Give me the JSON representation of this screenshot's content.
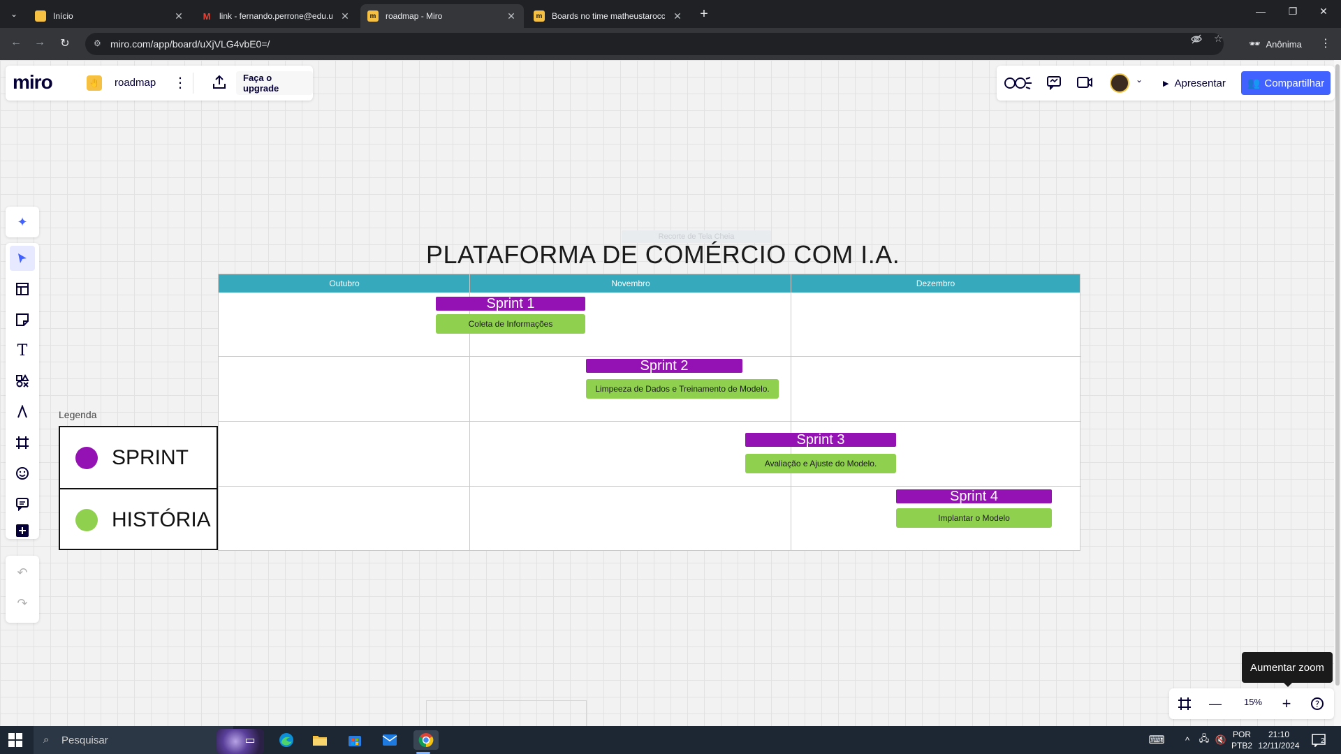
{
  "browser": {
    "tabs": [
      {
        "title": "Início",
        "favicon_color": "#f6c143",
        "favicon_glyph": "▣"
      },
      {
        "title": "link - fernando.perrone@edu.u",
        "favicon_color": "#ffffff",
        "favicon_glyph": "M"
      },
      {
        "title": "roadmap - Miro",
        "favicon_color": "#f6c143",
        "favicon_glyph": "m",
        "active": true
      },
      {
        "title": "Boards no time matheustarocc",
        "favicon_color": "#f6c143",
        "favicon_glyph": "m"
      }
    ],
    "url": "miro.com/app/board/uXjVLG4vbE0=/",
    "profile_label": "Anônima"
  },
  "miro": {
    "logo": "miro",
    "board_name": "roadmap",
    "upgrade_label": "Faça o upgrade",
    "present_label": "Apresentar",
    "share_label": "Compartilhar",
    "zoom_level": "15%",
    "tooltip": "Aumentar zoom",
    "brand_color": "#4262ff"
  },
  "board": {
    "ghost_label": "Recorte de Tela Cheia",
    "title": "PLATAFORMA DE COMÉRCIO COM I.A.",
    "months": [
      "Outubro",
      "Novembro",
      "Dezembro"
    ],
    "header_color": "#36a9bd",
    "sprints": [
      {
        "label": "Sprint 1",
        "story": "Coleta de Informações"
      },
      {
        "label": "Sprint 2",
        "story": "Limpeeza de Dados e Treinamento de Modelo."
      },
      {
        "label": "Sprint 3",
        "story": "Avaliação e Ajuste do Modelo."
      },
      {
        "label": "Sprint 4",
        "story": "Implantar o Modelo"
      }
    ],
    "sprint_color": "#9412b3",
    "story_color": "#8fd14f"
  },
  "legend": {
    "title": "Legenda",
    "items": [
      {
        "label": "SPRINT",
        "color": "#9412b3"
      },
      {
        "label": "HISTÓRIA",
        "color": "#8fd14f"
      }
    ]
  },
  "taskbar": {
    "search_placeholder": "Pesquisar",
    "lang_top": "POR",
    "lang_bottom": "PTB2",
    "time": "21:10",
    "date": "12/11/2024",
    "notification_count": "2"
  }
}
